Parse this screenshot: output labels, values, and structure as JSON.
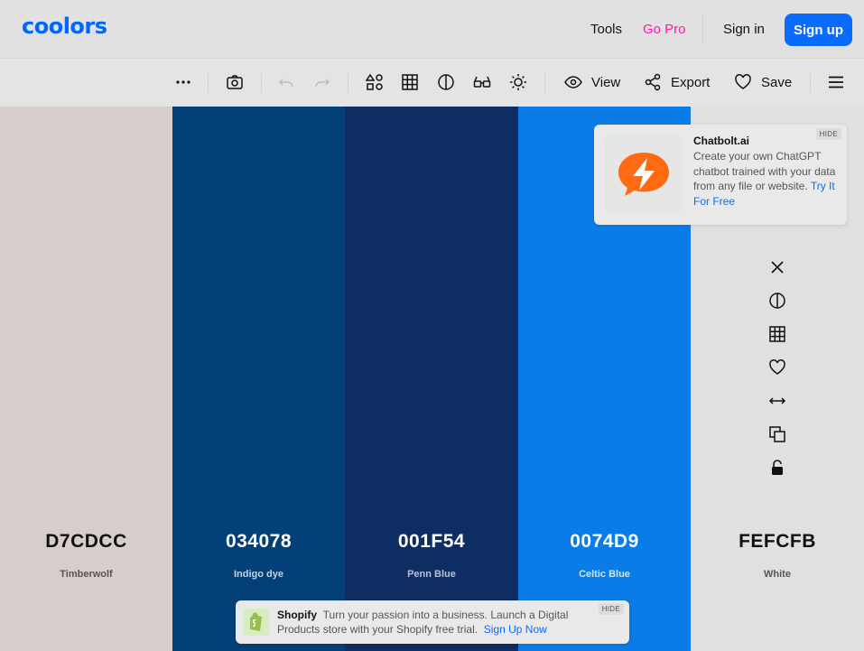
{
  "header": {
    "logo": "coolors",
    "nav": {
      "tools": "Tools",
      "go_pro": "Go Pro",
      "sign_in": "Sign in",
      "sign_up": "Sign up"
    }
  },
  "toolbar": {
    "icons": [
      "more-icon",
      "camera-icon",
      "undo-icon",
      "redo-icon",
      "shapes-icon",
      "grid-icon",
      "contrast-icon",
      "glasses-icon",
      "sun-icon"
    ],
    "view_label": "View",
    "export_label": "Export",
    "save_label": "Save"
  },
  "palette": {
    "colors": [
      {
        "hex": "D7CDCC",
        "name": "Timberwolf",
        "bg": "#D7CDCC",
        "text_color": "#111111",
        "name_color": "#555555"
      },
      {
        "hex": "034078",
        "name": "Indigo dye",
        "bg": "#034078",
        "text_color": "#FFFFFF",
        "name_color": "#C4D3E3"
      },
      {
        "hex": "001F54",
        "name": "Penn Blue",
        "bg": "#0E2D63",
        "text_color": "#FFFFFF",
        "name_color": "#B8C2D6"
      },
      {
        "hex": "0074D9",
        "name": "Celtic Blue",
        "bg": "#0A7CE8",
        "text_color": "#FFFFFF",
        "name_color": "#CFE4FA"
      },
      {
        "hex": "FEFCFB",
        "name": "White",
        "bg": "#E2E0DF",
        "text_color": "#111111",
        "name_color": "#555555"
      }
    ],
    "hover_tools": [
      "remove-icon",
      "contrast-icon",
      "shades-icon",
      "favorite-icon",
      "drag-icon",
      "copy-icon",
      "lock-icon"
    ]
  },
  "ads": {
    "top": {
      "brand": "Chatbolt.ai",
      "body": "Create your own ChatGPT chatbot trained with your data from any file or website.",
      "cta": "Try It For Free",
      "hide": "HIDE"
    },
    "bottom": {
      "brand": "Shopify",
      "body": "Turn your passion into a business. Launch a Digital Products store with your Shopify free trial.",
      "cta": "Sign Up Now",
      "hide": "HIDE"
    }
  },
  "colors": {
    "accent": "#0A6CFF",
    "go_pro": "#FF1AA8",
    "chatbolt_orange": "#FF6A13",
    "shopify_green": "#95BF47"
  }
}
